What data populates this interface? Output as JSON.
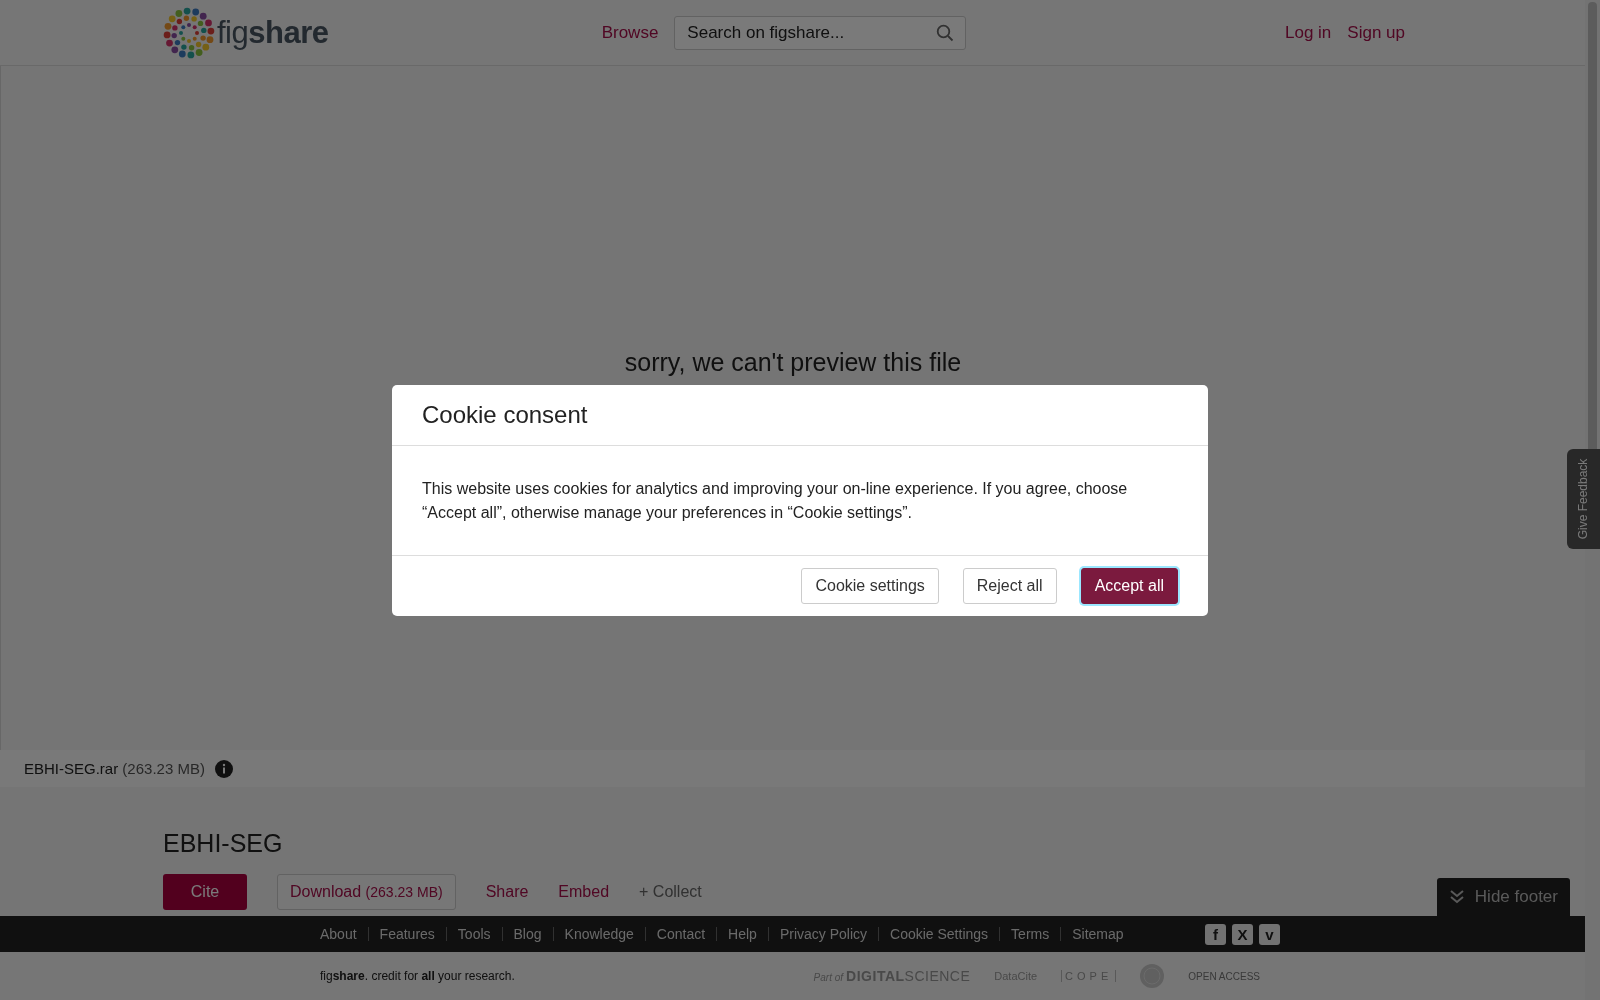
{
  "header": {
    "brand": "fig**share**",
    "nav": [
      {
        "label": "Browse"
      }
    ],
    "search": {
      "placeholder": "Search on figshare..."
    },
    "auth": [
      {
        "label": "Log in"
      },
      {
        "label": "Sign up"
      }
    ]
  },
  "preview": {
    "message": "sorry, we can't preview this file"
  },
  "feedback_tab": {
    "label": "Give Feedback"
  },
  "file": {
    "name": "EBHI-SEG.rar",
    "size": "(263.23 MB)"
  },
  "item": {
    "title": "EBHI-SEG",
    "actions": [
      {
        "label": "Cite",
        "kind": "primary"
      },
      {
        "label": "Download",
        "size": "(263.23 MB)",
        "kind": "outline"
      },
      {
        "label": "Share",
        "kind": "link"
      },
      {
        "label": "Embed",
        "kind": "link"
      },
      {
        "label": "+ Collect",
        "kind": "muted"
      }
    ]
  },
  "hide_footer": {
    "label": "Hide footer"
  },
  "footer": {
    "links": [
      "About",
      "Features",
      "Tools",
      "Blog",
      "Knowledge",
      "Contact",
      "Help",
      "Privacy Policy",
      "Cookie Settings",
      "Terms",
      "Sitemap"
    ],
    "social": [
      {
        "glyph": "f"
      },
      {
        "glyph": "X"
      },
      {
        "glyph": "v"
      }
    ],
    "tagline": "fig**share**. credit for **all** your research.",
    "partners": [
      {
        "kind": "digital-science",
        "prefix": "Part of",
        "text": "**DIGITAL**SCIENCE"
      },
      {
        "kind": "datacite",
        "text": "DataCite"
      },
      {
        "kind": "cope",
        "text": "COPE"
      },
      {
        "kind": "seal"
      },
      {
        "kind": "open-access",
        "text": "OPEN ACCESS"
      }
    ]
  },
  "cookie_modal": {
    "title": "Cookie consent",
    "body": "This website uses cookies for analytics and improving your on-line experience. If you agree, choose “Accept all”, otherwise manage your preferences in “Cookie settings”.",
    "buttons": [
      {
        "label": "Cookie settings",
        "kind": "secondary",
        "focused": false
      },
      {
        "label": "Reject all",
        "kind": "secondary",
        "focused": false
      },
      {
        "label": "Accept all",
        "kind": "primary",
        "focused": true
      }
    ]
  }
}
